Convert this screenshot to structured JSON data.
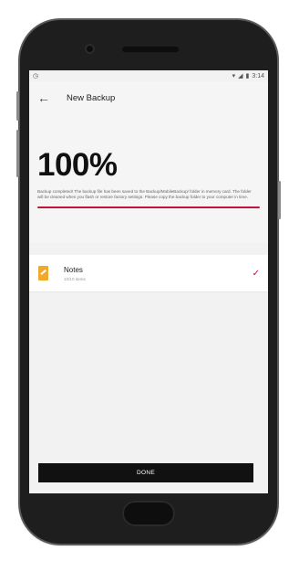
{
  "status_bar": {
    "time": "3:14"
  },
  "header": {
    "back_icon": "arrow-left-icon",
    "title": "New Backup"
  },
  "progress": {
    "percent_label": "100%",
    "value": 1.0,
    "description": "Backup completed! The backup file has been saved to the Backup/MobileBackup/ folder in memory card. The folder will be cleaned when you flash or restore factory settings. Please copy the backup folder to your computer in time.",
    "bar_color": "#c0143a"
  },
  "items": [
    {
      "title": "Notes",
      "subtitle": "10/10  items",
      "icon": "notes-icon",
      "status_icon": "check-icon"
    }
  ],
  "done_button": {
    "label": "DONE"
  }
}
